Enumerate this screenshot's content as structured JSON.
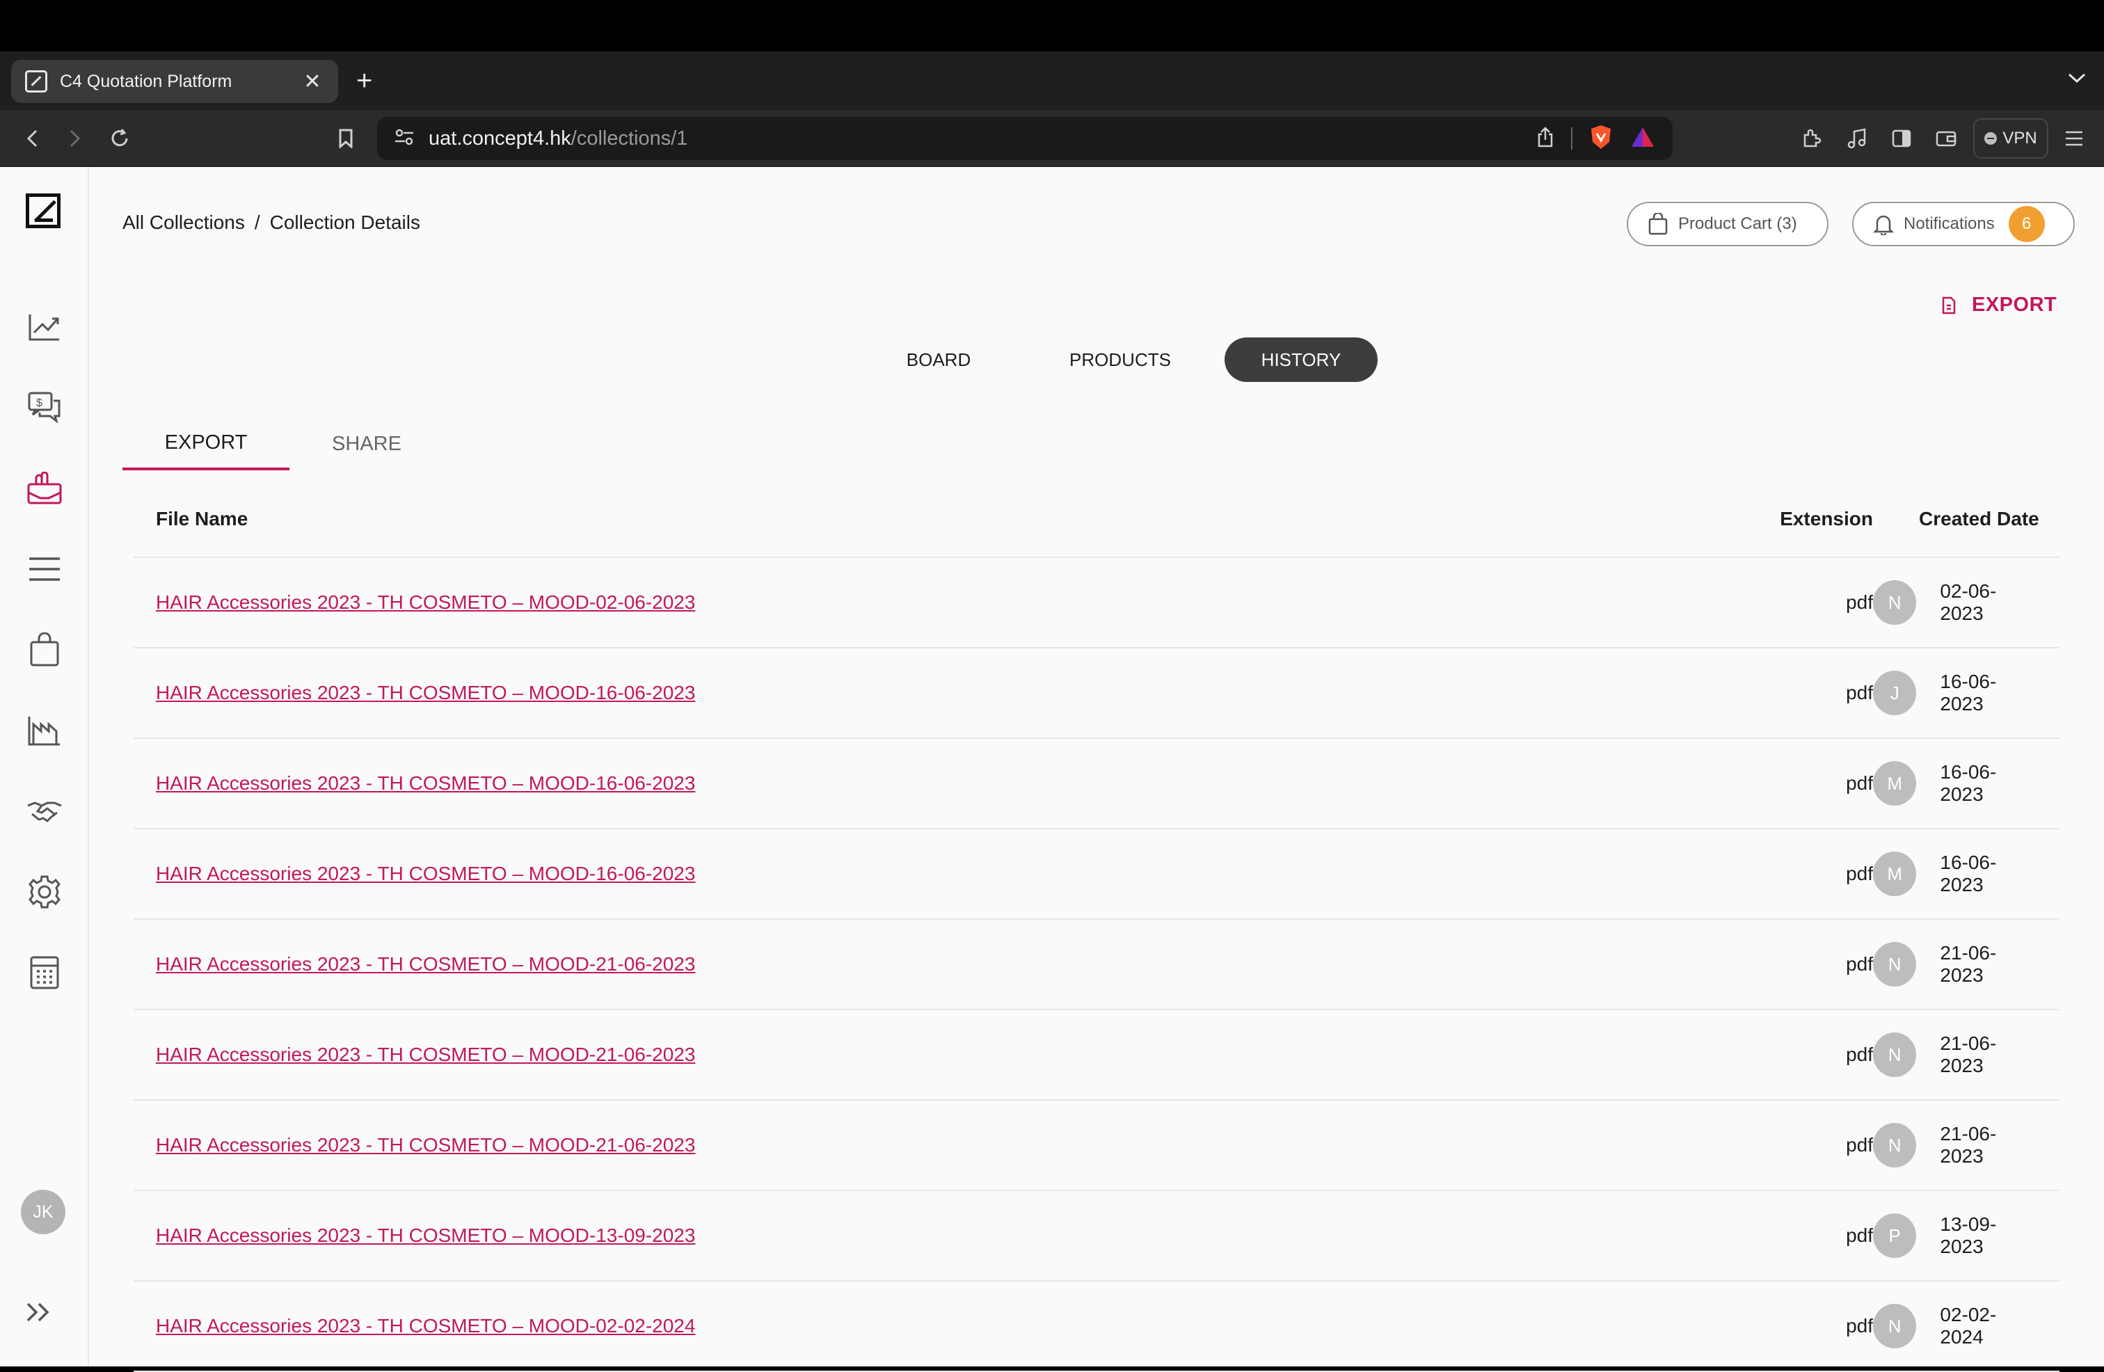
{
  "browser": {
    "tab_title": "C4 Quotation Platform",
    "url_host": "uat.concept4.hk",
    "url_path": "/collections/1",
    "vpn_label": "VPN"
  },
  "breadcrumb": {
    "root": "All Collections",
    "separator": "/",
    "current": "Collection Details"
  },
  "header": {
    "cart_label": "Product Cart (3)",
    "notifications_label": "Notifications",
    "notifications_count": "6"
  },
  "export_button": "EXPORT",
  "view_tabs": [
    "BOARD",
    "PRODUCTS",
    "HISTORY"
  ],
  "sub_tabs": [
    "EXPORT",
    "SHARE"
  ],
  "sidebar": {
    "user_initials": "JK",
    "icons": [
      "chart-line-icon",
      "chat-dollar-icon",
      "collections-icon",
      "menu-icon",
      "shopping-bag-icon",
      "factory-icon",
      "handshake-icon",
      "gear-icon",
      "calculator-icon"
    ]
  },
  "table": {
    "columns": {
      "name": "File Name",
      "extension": "Extension",
      "date": "Created Date"
    },
    "rows": [
      {
        "name": "HAIR Accessories 2023 - TH COSMETO – MOOD-02-06-2023",
        "ext": "pdf",
        "user": "N",
        "date": "02-06-2023"
      },
      {
        "name": "HAIR Accessories 2023 - TH COSMETO – MOOD-16-06-2023",
        "ext": "pdf",
        "user": "J",
        "date": "16-06-2023"
      },
      {
        "name": "HAIR Accessories 2023 - TH COSMETO – MOOD-16-06-2023",
        "ext": "pdf",
        "user": "M",
        "date": "16-06-2023"
      },
      {
        "name": "HAIR Accessories 2023 - TH COSMETO – MOOD-16-06-2023",
        "ext": "pdf",
        "user": "M",
        "date": "16-06-2023"
      },
      {
        "name": "HAIR Accessories 2023 - TH COSMETO – MOOD-21-06-2023",
        "ext": "pdf",
        "user": "N",
        "date": "21-06-2023"
      },
      {
        "name": "HAIR Accessories 2023 - TH COSMETO – MOOD-21-06-2023",
        "ext": "pdf",
        "user": "N",
        "date": "21-06-2023"
      },
      {
        "name": "HAIR Accessories 2023 - TH COSMETO – MOOD-21-06-2023",
        "ext": "pdf",
        "user": "N",
        "date": "21-06-2023"
      },
      {
        "name": "HAIR Accessories 2023 - TH COSMETO – MOOD-13-09-2023",
        "ext": "pdf",
        "user": "P",
        "date": "13-09-2023"
      },
      {
        "name": "HAIR Accessories 2023 - TH COSMETO – MOOD-02-02-2024",
        "ext": "pdf",
        "user": "N",
        "date": "02-02-2024"
      }
    ]
  },
  "colors": {
    "accent": "#c2185b",
    "badge": "#f0a030",
    "active_tab_bg": "#3d3d3d"
  }
}
